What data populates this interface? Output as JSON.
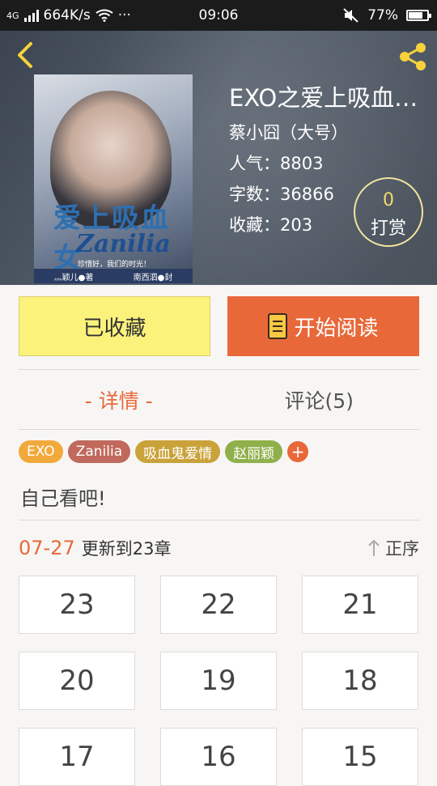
{
  "status_bar": {
    "network": "4G",
    "speed": "664K/s",
    "more": "···",
    "time": "09:06",
    "battery": "77%",
    "battery_level": 0.77
  },
  "book": {
    "title": "EXO之爱上吸血…",
    "author": "蔡小囧（大号）",
    "popularity": "人气：8803",
    "words": "字数：36866",
    "favorites": "收藏：203",
    "tip_count": "0",
    "tip_label": "打赏",
    "cover": {
      "title_cn": "爱上吸血女",
      "title_en": "Zanilia",
      "tagline": "珍惜好，我们的时光！",
      "author_credit": "灬颖儿●著",
      "cover_credit": "南西泗●封"
    }
  },
  "actions": {
    "favorited_label": "已收藏",
    "read_label": "开始阅读"
  },
  "tabs": [
    {
      "label": "- 详情 -"
    },
    {
      "label": "评论(5)"
    }
  ],
  "tags": [
    {
      "label": "EXO",
      "color": "#f2a93b"
    },
    {
      "label": "Zanilia",
      "color": "#c0695c"
    },
    {
      "label": "吸血鬼爱情",
      "color": "#c9a23a"
    },
    {
      "label": "赵丽颖",
      "color": "#8fb04a"
    }
  ],
  "tag_add": "+",
  "description": "自己看吧!",
  "update": {
    "date": "07-27",
    "text": "更新到23章",
    "sort_label": "正序"
  },
  "chapters": [
    "23",
    "22",
    "21",
    "20",
    "19",
    "18",
    "17",
    "16",
    "15"
  ],
  "colors": {
    "accent": "#e8683a",
    "favorited_bg": "#fbf27c",
    "tip_number": "#f5d86a"
  }
}
